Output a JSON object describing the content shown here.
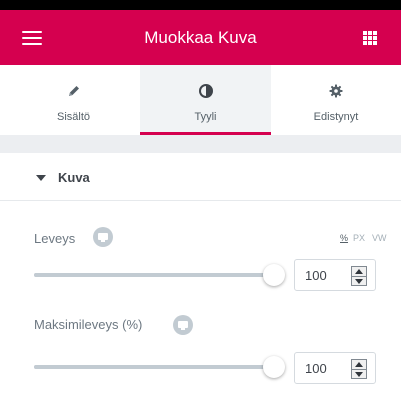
{
  "header": {
    "title": "Muokkaa Kuva",
    "menu_icon": "hamburger-menu-icon",
    "apps_icon": "grid-icon"
  },
  "tabs": [
    {
      "label": "Sisältö",
      "icon": "pencil-icon",
      "active": false
    },
    {
      "label": "Tyyli",
      "icon": "half-circle-contrast-icon",
      "active": true
    },
    {
      "label": "Edistynyt",
      "icon": "gear-icon",
      "active": false
    }
  ],
  "section": {
    "title": "Kuva",
    "expanded": true
  },
  "controls": {
    "width": {
      "label": "Leveys",
      "value": "100",
      "slider_percent": 100,
      "units": [
        "%",
        "PX",
        "VW"
      ],
      "active_unit": "%"
    },
    "max_width": {
      "label": "Maksimileveys (%)",
      "value": "100",
      "slider_percent": 100
    }
  },
  "colors": {
    "accent": "#d5004f",
    "topbar_edge": "#000000",
    "panel_bg": "#ffffff",
    "active_tab_bg": "#f1f3f5",
    "separator_bg": "#eceef1"
  }
}
